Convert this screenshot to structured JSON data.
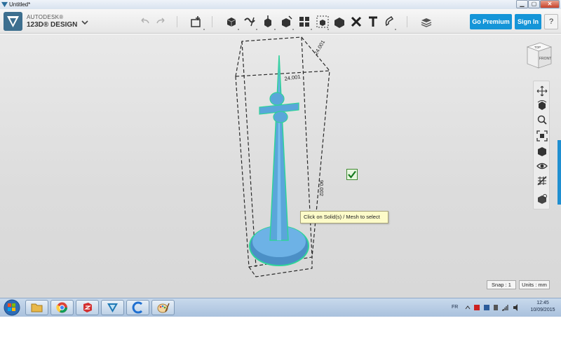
{
  "window": {
    "title": "Untitled*",
    "controls": {
      "minimize": "▁",
      "maximize": "▢",
      "close": "✕"
    }
  },
  "brand": {
    "line1": "AUTODESK®",
    "line2": "123D® DESIGN"
  },
  "toolbar": {
    "icons": [
      "undo-icon",
      "redo-icon",
      "import-icon",
      "primitives-icon",
      "sketch-icon",
      "construct-icon",
      "modify-icon",
      "pattern-icon",
      "grouping-icon",
      "combine-icon",
      "measure-icon",
      "text-icon",
      "snap-icon",
      "material-icon"
    ],
    "premium_label": "Go Premium",
    "signin_label": "Sign In",
    "help_label": "?"
  },
  "viewcube": {
    "top": "TOP",
    "front": "FRONT"
  },
  "side_tools": [
    "pan-icon",
    "orbit-icon",
    "zoom-icon",
    "fit-icon",
    "view-mode-icon",
    "visibility-icon",
    "grid-icon",
    "material-view-icon"
  ],
  "scene": {
    "dimension_top": "24.001",
    "dimension_side": "24.001",
    "dimension_height": "90.002"
  },
  "tooltip": "Click on Solid(s) / Mesh to select",
  "status": {
    "snap": "Snap : 1",
    "units": "Units : mm"
  },
  "taskbar": {
    "apps": [
      "explorer-icon",
      "chrome-icon",
      "sketchup-icon",
      "123d-icon",
      "ccleaner-icon",
      "paint-icon"
    ],
    "lang": "FR",
    "time": "12:45",
    "date": "10/09/2015"
  },
  "colors": {
    "accent": "#1595d8",
    "model": "#5aa6da",
    "selection": "#2fd39a"
  }
}
